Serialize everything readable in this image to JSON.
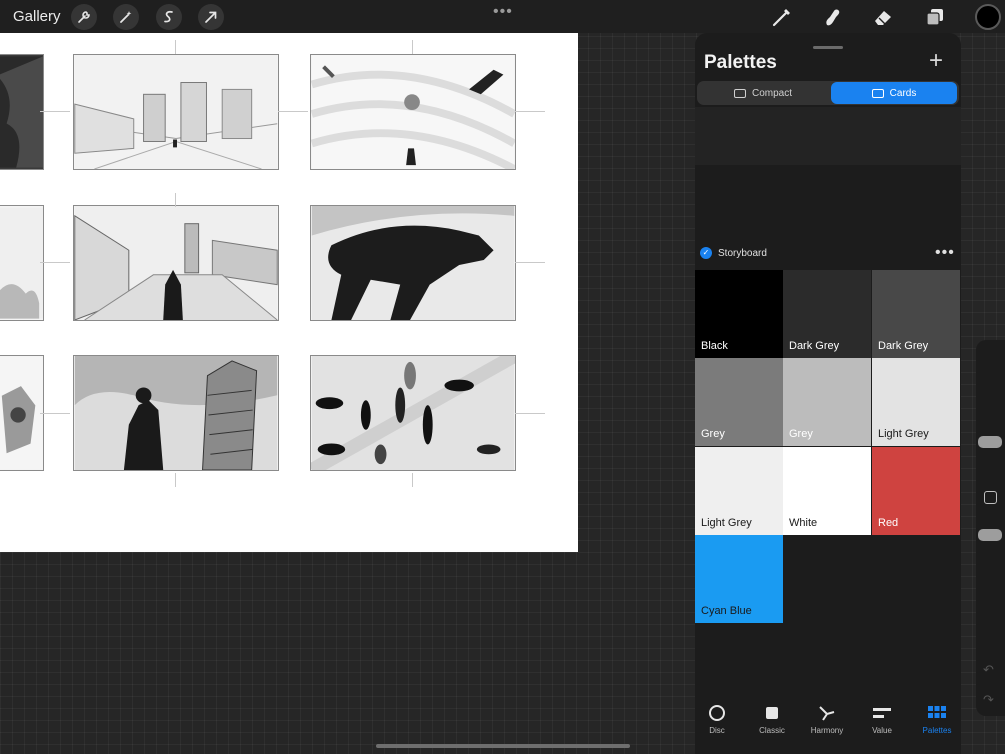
{
  "toolbar": {
    "gallery_label": "Gallery",
    "more_dots": "•••",
    "left_tools": [
      "actions-wrench-icon",
      "adjustments-wand-icon",
      "selection-s-icon",
      "transform-arrow-icon"
    ],
    "right_tools": [
      "brush-icon",
      "smudge-icon",
      "eraser-icon",
      "layers-icon"
    ],
    "current_color": "#000000"
  },
  "palettes": {
    "title": "Palettes",
    "add_icon": "+",
    "view_modes": [
      {
        "label": "Compact",
        "active": false
      },
      {
        "label": "Cards",
        "active": true
      }
    ],
    "active_palette": {
      "name": "Storyboard",
      "more": "•••",
      "swatches": [
        {
          "name": "Black",
          "color": "#000000",
          "text_color": "#ffffff"
        },
        {
          "name": "Dark Grey",
          "color": "#2b2b2b",
          "text_color": "#ffffff"
        },
        {
          "name": "Dark Grey",
          "color": "#484848",
          "text_color": "#ffffff"
        },
        {
          "name": "Grey",
          "color": "#7b7b7b",
          "text_color": "#ffffff"
        },
        {
          "name": "Grey",
          "color": "#bcbcbc",
          "text_color": "#ffffff"
        },
        {
          "name": "Light Grey",
          "color": "#e3e3e3",
          "text_color": "#1a1a1a"
        },
        {
          "name": "Light Grey",
          "color": "#efefef",
          "text_color": "#1a1a1a"
        },
        {
          "name": "White",
          "color": "#ffffff",
          "text_color": "#1a1a1a"
        },
        {
          "name": "Red",
          "color": "#cf4340",
          "text_color": "#ffffff"
        },
        {
          "name": "Cyan Blue",
          "color": "#1a9bf2",
          "text_color": "#1a1a1a"
        }
      ]
    },
    "tabs": [
      {
        "label": "Disc",
        "icon": "disc-icon",
        "active": false
      },
      {
        "label": "Classic",
        "icon": "classic-square-icon",
        "active": false
      },
      {
        "label": "Harmony",
        "icon": "harmony-icon",
        "active": false
      },
      {
        "label": "Value",
        "icon": "value-sliders-icon",
        "active": false
      },
      {
        "label": "Palettes",
        "icon": "palettes-grid-icon",
        "active": true
      }
    ]
  },
  "colors": {
    "accent": "#1a82f0",
    "panel_bg": "#1c1c1c"
  }
}
